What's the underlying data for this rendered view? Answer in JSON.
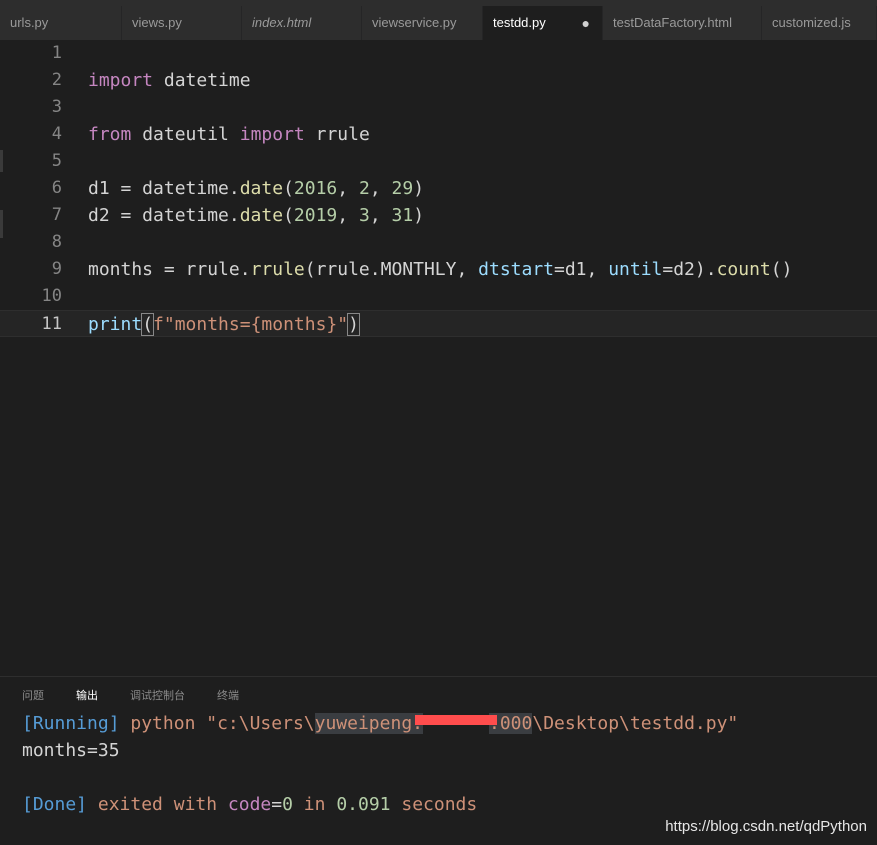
{
  "tabs": [
    {
      "label": "urls.py"
    },
    {
      "label": "views.py"
    },
    {
      "label": "index.html"
    },
    {
      "label": "viewservice.py"
    },
    {
      "label": "testdd.py",
      "modified_dot": "●"
    },
    {
      "label": "testDataFactory.html"
    },
    {
      "label": "customized.js"
    }
  ],
  "line_numbers": [
    "1",
    "2",
    "3",
    "4",
    "5",
    "6",
    "7",
    "8",
    "9",
    "10",
    "11"
  ],
  "code": {
    "l2": {
      "kw": "import",
      "rest": " datetime"
    },
    "l4": {
      "kw1": "from",
      "mid": " dateutil ",
      "kw2": "import",
      "rest": " rrule"
    },
    "l6": {
      "a": "d1 = datetime.",
      "fn": "date",
      "b": "(",
      "n1": "2016",
      "c": ", ",
      "n2": "2",
      "d": ", ",
      "n3": "29",
      "e": ")"
    },
    "l7": {
      "a": "d2 = datetime.",
      "fn": "date",
      "b": "(",
      "n1": "2019",
      "c": ", ",
      "n2": "3",
      "d": ", ",
      "n3": "31",
      "e": ")"
    },
    "l9": {
      "a": "months = rrule.",
      "fn": "rrule",
      "b": "(rrule.MONTHLY, ",
      "p1": "dtstart",
      "c": "=d1, ",
      "p2": "until",
      "d": "=d2).",
      "fn2": "count",
      "e": "()"
    },
    "l11": {
      "fn": "print",
      "p1": "(",
      "str": "f\"months={months}\"",
      "p2": ")"
    }
  },
  "panel": {
    "tabs": [
      "问题",
      "输出",
      "调试控制台",
      "终端"
    ],
    "output": {
      "running_tag": "[Running]",
      "cmd": " python \"c:\\Users\\",
      "user_a": "yuweipeng.",
      "user_b": ".000",
      "path_rest": "\\Desktop\\testdd.py\"",
      "result": "months=35",
      "done_tag": "[Done]",
      "exited": " exited with ",
      "code_kw": "code",
      "eq": "=",
      "code_val": "0",
      "in_kw": " in ",
      "secs": "0.091",
      "secs_word": " seconds"
    }
  },
  "watermark": "https://blog.csdn.net/qdPython"
}
